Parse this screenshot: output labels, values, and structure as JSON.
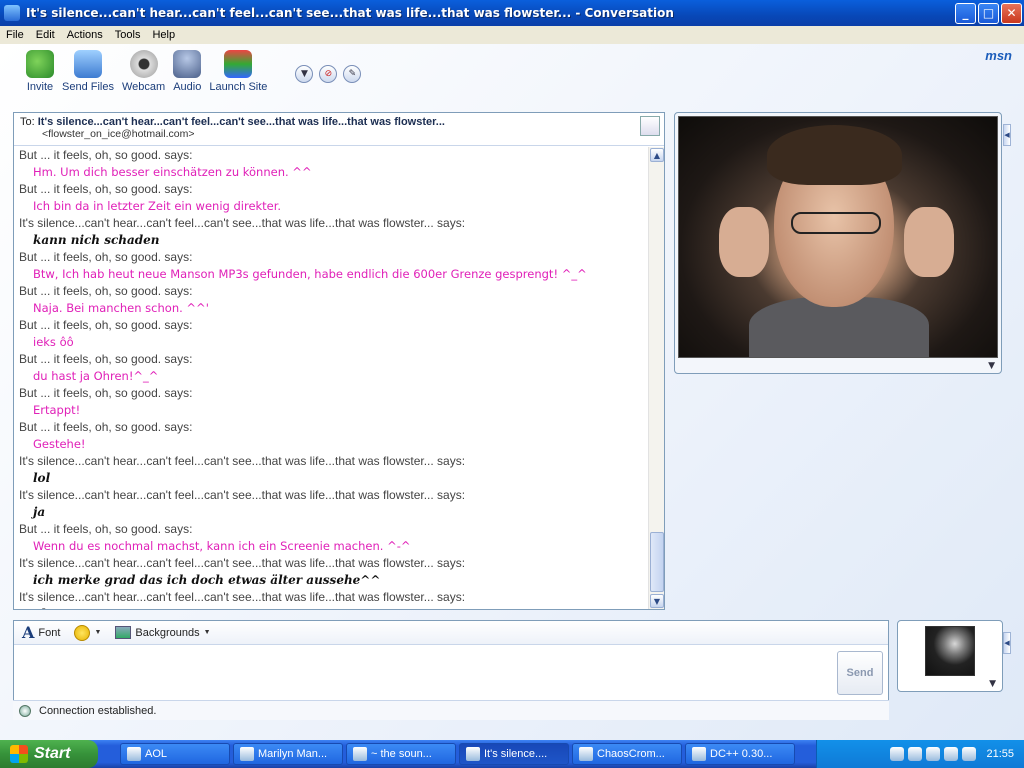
{
  "window": {
    "title": "It's silence...can't hear...can't feel...can't see...that was life...that was flowster... - Conversation",
    "min_label": "_",
    "max_label": "□",
    "close_label": "✕"
  },
  "menu": [
    "File",
    "Edit",
    "Actions",
    "Tools",
    "Help"
  ],
  "toolbar": {
    "buttons": [
      {
        "label": "Invite",
        "icon": "invite-icon"
      },
      {
        "label": "Send Files",
        "icon": "send-files-icon"
      },
      {
        "label": "Webcam",
        "icon": "webcam-icon"
      },
      {
        "label": "Audio",
        "icon": "audio-icon"
      },
      {
        "label": "Launch Site",
        "icon": "launch-site-icon"
      }
    ],
    "logo": "msn"
  },
  "to": {
    "label": "To:",
    "name": "It's silence...can't hear...can't feel...can't see...that was life...that was flowster...",
    "email": "<flowster_on_ice@hotmail.com>"
  },
  "messages": [
    {
      "who": "But ... it feels, oh, so good. says:",
      "text": "Hm. Um dich besser einschätzen zu können. ^^",
      "side": "them"
    },
    {
      "who": "But ... it feels, oh, so good. says:",
      "text": "Ich bin da in letzter Zeit ein wenig direkter.",
      "side": "them"
    },
    {
      "who": "It's silence...can't hear...can't feel...can't see...that was life...that was flowster... says:",
      "text": "kann nich schaden",
      "side": "me"
    },
    {
      "who": "But ... it feels, oh, so good. says:",
      "text": "Btw, Ich hab heut neue Manson MP3s gefunden, habe endlich die 600er Grenze gesprengt! ^_^",
      "side": "them"
    },
    {
      "who": "But ... it feels, oh, so good. says:",
      "text": "Naja. Bei manchen schon. ^^'",
      "side": "them"
    },
    {
      "who": "But ... it feels, oh, so good. says:",
      "text": "ieks ôô",
      "side": "them"
    },
    {
      "who": "But ... it feels, oh, so good. says:",
      "text": "du hast ja Ohren!^_^",
      "side": "them"
    },
    {
      "who": "But ... it feels, oh, so good. says:",
      "text": "Ertappt!",
      "side": "them"
    },
    {
      "who": "But ... it feels, oh, so good. says:",
      "text": "Gestehe!",
      "side": "them"
    },
    {
      "who": "It's silence...can't hear...can't feel...can't see...that was life...that was flowster... says:",
      "text": "lol",
      "side": "me"
    },
    {
      "who": "It's silence...can't hear...can't feel...can't see...that was life...that was flowster... says:",
      "text": "ja",
      "side": "me"
    },
    {
      "who": "But ... it feels, oh, so good. says:",
      "text": "Wenn du es nochmal machst, kann ich ein Screenie machen. ^-^",
      "side": "them"
    },
    {
      "who": "It's silence...can't hear...can't feel...can't see...that was life...that was flowster... says:",
      "text": "ich merke grad das ich doch etwas älter aussehe^^",
      "side": "me"
    },
    {
      "who": "It's silence...can't hear...can't feel...can't see...that was life...that was flowster... says:",
      "text": "okay",
      "side": "me"
    }
  ],
  "compose": {
    "font_label": "Font",
    "backgrounds_label": "Backgrounds",
    "send_label": "Send",
    "status": "Connection established."
  },
  "taskbar": {
    "start_label": "Start",
    "tasks": [
      {
        "label": "AOL",
        "active": false
      },
      {
        "label": "Marilyn Man...",
        "active": false
      },
      {
        "label": "~ the soun...",
        "active": false
      },
      {
        "label": "It's silence....",
        "active": true
      },
      {
        "label": "ChaosCrom...",
        "active": false
      },
      {
        "label": "DC++ 0.30...",
        "active": false
      }
    ],
    "clock": "21:55"
  }
}
